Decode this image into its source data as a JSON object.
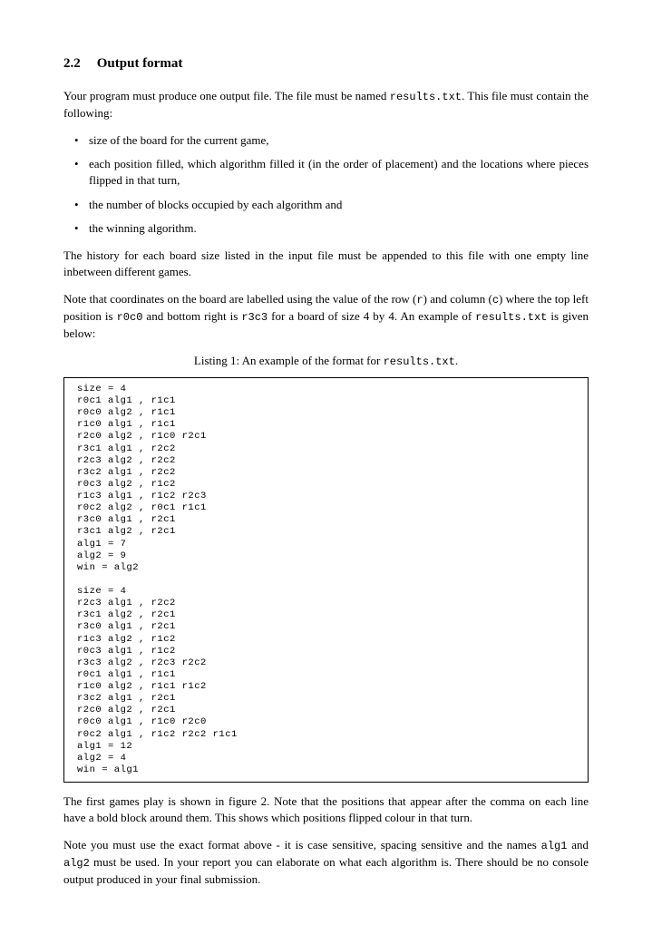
{
  "section": {
    "number": "2.2",
    "title": "Output format"
  },
  "para1_a": "Your program must produce one output file. The file must be named ",
  "para1_code": "results.txt",
  "para1_b": ". This file must contain the following:",
  "bullets": [
    "size of the board for the current game,",
    "each position filled, which algorithm filled it (in the order of placement) and the locations where pieces flipped in that turn,",
    "the number of blocks occupied by each algorithm and",
    "the winning algorithm."
  ],
  "para2": "The history for each board size listed in the input file must be appended to this file with one empty line inbetween different games.",
  "para3_a": "Note that coordinates on the board are labelled using the value of the row (",
  "para3_code1": "r",
  "para3_b": ") and column (",
  "para3_code2": "c",
  "para3_c": ") where the top left position is ",
  "para3_code3": "r0c0",
  "para3_d": " and bottom right is ",
  "para3_code4": "r3c3",
  "para3_e": " for a board of size 4 by 4. An example of ",
  "para3_code5": "results.txt",
  "para3_f": " is given below:",
  "listing_caption_a": "Listing 1: An example of the format for ",
  "listing_caption_code": "results.txt",
  "listing_caption_b": ".",
  "listing": "size = 4\nr0c1 alg1 , r1c1\nr0c0 alg2 , r1c1\nr1c0 alg1 , r1c1\nr2c0 alg2 , r1c0 r2c1\nr3c1 alg1 , r2c2\nr2c3 alg2 , r2c2\nr3c2 alg1 , r2c2\nr0c3 alg2 , r1c2\nr1c3 alg1 , r1c2 r2c3\nr0c2 alg2 , r0c1 r1c1\nr3c0 alg1 , r2c1\nr3c1 alg2 , r2c1\nalg1 = 7\nalg2 = 9\nwin = alg2\n\nsize = 4\nr2c3 alg1 , r2c2\nr3c1 alg2 , r2c1\nr3c0 alg1 , r2c1\nr1c3 alg2 , r1c2\nr0c3 alg1 , r1c2\nr3c3 alg2 , r2c3 r2c2\nr0c1 alg1 , r1c1\nr1c0 alg2 , r1c1 r1c2\nr3c2 alg1 , r2c1\nr2c0 alg2 , r2c1\nr0c0 alg1 , r1c0 r2c0\nr0c2 alg1 , r1c2 r2c2 r1c1\nalg1 = 12\nalg2 = 4\nwin = alg1",
  "para4": "The first games play is shown in figure 2. Note that the positions that appear after the comma on each line have a bold block around them. This shows which positions flipped colour in that turn.",
  "para5_a": "Note you must use the exact format above - it is case sensitive, spacing sensitive and the names ",
  "para5_code1": "alg1",
  "para5_b": " and ",
  "para5_code2": "alg2",
  "para5_c": " must be used. In your report you can elaborate on what each algorithm is. There should be no console output produced in your final submission."
}
